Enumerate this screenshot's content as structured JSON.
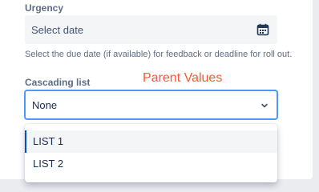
{
  "urgency": {
    "label": "Urgency",
    "placeholder": "Select date",
    "icon": "calendar-icon",
    "help": "Select the due date (if available) for feedback or deadline for roll out."
  },
  "annotation": {
    "text": "Parent Values",
    "color": "#ff5630"
  },
  "cascading": {
    "label": "Cascading list",
    "value": "None",
    "icon": "chevron-down-icon",
    "options": [
      {
        "label": "LIST 1",
        "highlighted": true
      },
      {
        "label": "LIST 2",
        "highlighted": false
      }
    ]
  },
  "colors": {
    "focus_border": "#4c9aff",
    "selected_bar": "#0052cc"
  }
}
